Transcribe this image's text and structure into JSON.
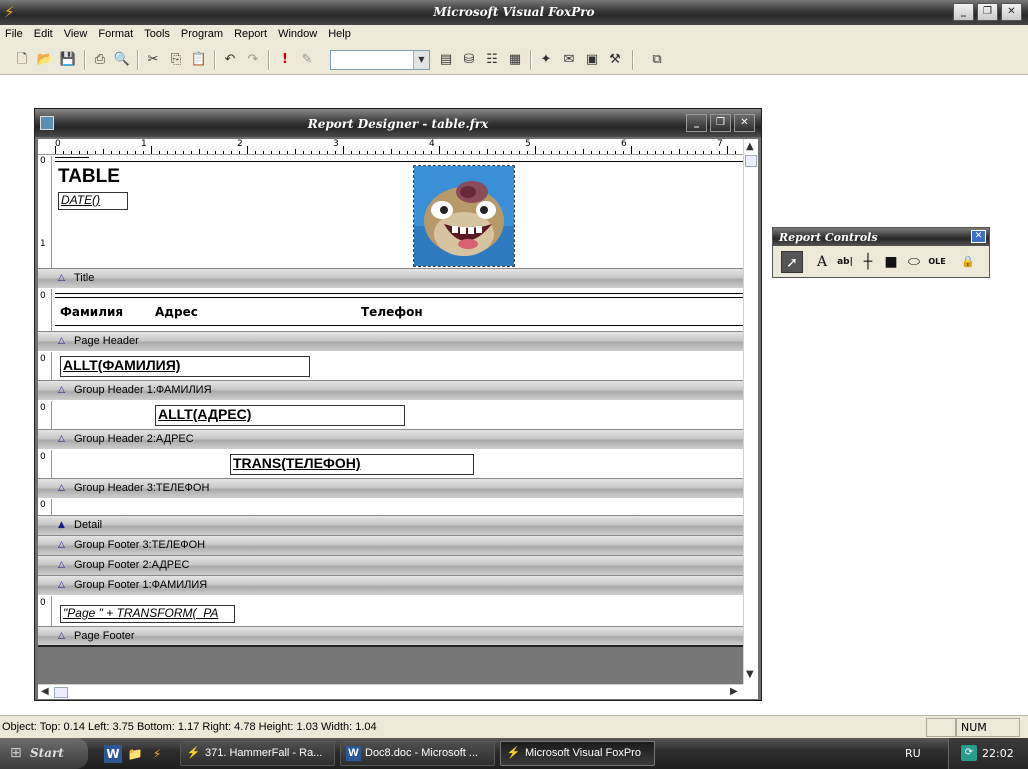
{
  "app": {
    "title": "Microsoft Visual FoxPro"
  },
  "menu": [
    "File",
    "Edit",
    "View",
    "Format",
    "Tools",
    "Program",
    "Report",
    "Window",
    "Help"
  ],
  "toolbar": {
    "buttons": [
      "new-icon",
      "open-icon",
      "save-icon",
      "print-icon",
      "print-preview-icon",
      "cut-icon",
      "copy-icon",
      "paste-icon",
      "undo-icon",
      "redo-icon",
      "run-icon",
      "modify-form-icon",
      "command-window-icon",
      "data-session-icon",
      "properties-icon",
      "code-window-icon",
      "form-wizard-icon",
      "report-wizard-icon",
      "autoform-icon",
      "build-icon",
      "forms-icon"
    ],
    "combo_value": ""
  },
  "report_designer": {
    "title": "Report Designer - table.frx",
    "ruler_numbers": [
      "0",
      "1",
      "2",
      "3",
      "4",
      "5",
      "6",
      "7"
    ],
    "title_band": {
      "heading": "TABLE",
      "date_field": "DATE()",
      "image_desc": "picture"
    },
    "page_header": {
      "col1": "Фамилия",
      "col2": "Адрес",
      "col3": "Телефон"
    },
    "fields": {
      "group1": "ALLT(ФАМИЛИЯ)",
      "group2": "ALLT(АДРЕС)",
      "group3": "TRANS(ТЕЛЕФОН)",
      "footer": "\"Page \" + TRANSFORM(_PA"
    },
    "bands": {
      "title": "Title",
      "page_header": "Page Header",
      "gh1": "Group Header 1:ФАМИЛИЯ",
      "gh2": "Group Header 2:АДРЕС",
      "gh3": "Group Header 3:ТЕЛЕФОН",
      "detail": "Detail",
      "gf3": "Group Footer 3:ТЕЛЕФОН",
      "gf2": "Group Footer 2:АДРЕС",
      "gf1": "Group Footer 1:ФАМИЛИЯ",
      "page_footer": "Page Footer"
    },
    "vruler_labels": {
      "zero": "0",
      "one": "1"
    }
  },
  "report_controls": {
    "title": "Report Controls",
    "tools": [
      "pointer-icon",
      "label-icon",
      "field-icon",
      "line-icon",
      "rectangle-icon",
      "rounded-rectangle-icon",
      "picture-ole-icon",
      "button-lock-icon"
    ]
  },
  "status": {
    "text": "Object: Top: 0.14  Left: 3.75  Bottom: 1.17  Right: 4.78  Height: 1.03  Width: 1.04",
    "num": "NUM"
  },
  "taskbar": {
    "start": "Start",
    "tasks": [
      "371. HammerFall - Ra...",
      "Doc8.doc - Microsoft ...",
      "Microsoft Visual FoxPro"
    ],
    "lang": "RU",
    "clock": "22:02"
  }
}
